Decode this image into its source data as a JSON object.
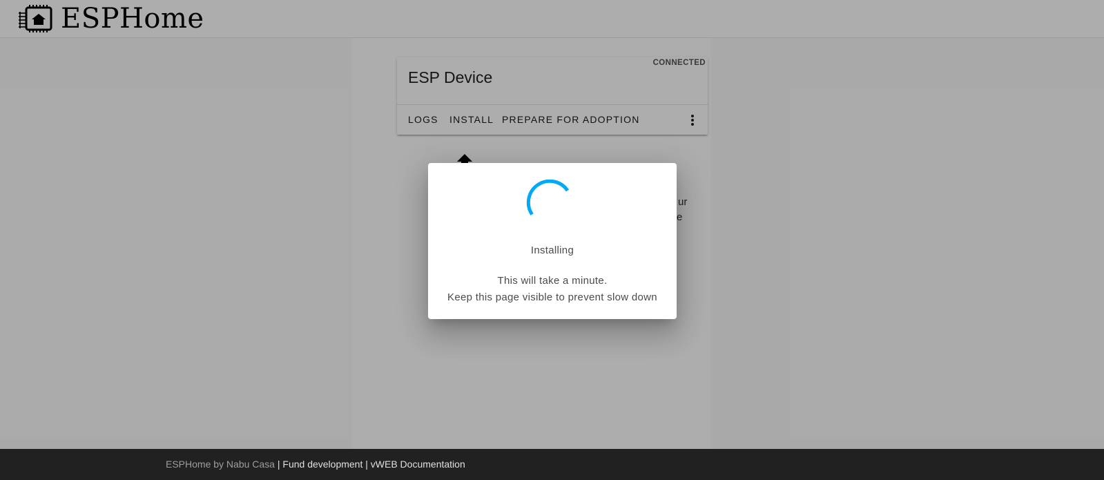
{
  "header": {
    "logo_icon": "esphome-chip-house-icon",
    "title": "ESPHome"
  },
  "card": {
    "status": "CONNECTED",
    "title": "ESP Device",
    "actions": {
      "logs": "LOGS",
      "install": "INSTALL",
      "adopt": "PREPARE FOR ADOPTION"
    },
    "menu_icon": "more-vertical-icon"
  },
  "background_hint": {
    "line1_fragment": "ur",
    "line2_fragment": "e"
  },
  "dialog": {
    "spinner_color": "#03a9f4",
    "title": "Installing",
    "line1": "This will take a minute.",
    "line2": "Keep this page visible to prevent slow down"
  },
  "footer": {
    "byline": "ESPHome by Nabu Casa",
    "sep1": " | ",
    "fund": "Fund development",
    "sep2": " | ",
    "version": "v",
    "docs": "WEB Documentation"
  }
}
